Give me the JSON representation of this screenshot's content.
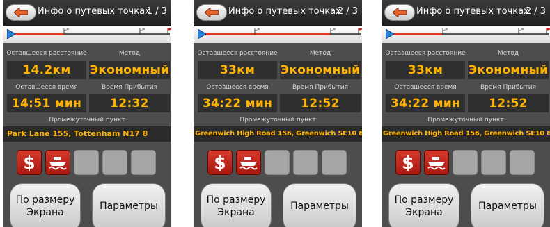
{
  "header": {
    "title": "Инфо о путевых точках",
    "back_icon": "back-arrow-icon"
  },
  "labels": {
    "remaining_distance": "Оставшееся расстояние",
    "method": "Метод",
    "remaining_time": "Оставшееся время",
    "arrival_time": "Время Прибытия",
    "waypoint": "Промежуточный пункт"
  },
  "buttons": {
    "fit_line1": "По размеру",
    "fit_line2": "Экрана",
    "params": "Параметры"
  },
  "icons": [
    "toll-road-icon",
    "ferry-icon"
  ],
  "colors": {
    "value_text": "#ffb400",
    "route_done": "#e0392b",
    "restriction_red": "#c22a1e"
  },
  "screens": [
    {
      "page": "1 / 3",
      "remaining_distance": "14.2км",
      "method": "Экономный",
      "remaining_time": "14:51 мин",
      "arrival_time": "12:32",
      "waypoint": "Park Lane 155, Tottenham N17 8"
    },
    {
      "page": "2 / 3",
      "remaining_distance": "33км",
      "method": "Экономный",
      "remaining_time": "34:22 мин",
      "arrival_time": "12:52",
      "waypoint": "Greenwich High Road 156, Greenwich SE10 8"
    },
    {
      "page": "2 / 3",
      "remaining_distance": "33км",
      "method": "Экономный",
      "remaining_time": "34:22 мин",
      "arrival_time": "12:52",
      "waypoint": "Greenwich High Road 156, Greenwich SE10 8"
    }
  ]
}
